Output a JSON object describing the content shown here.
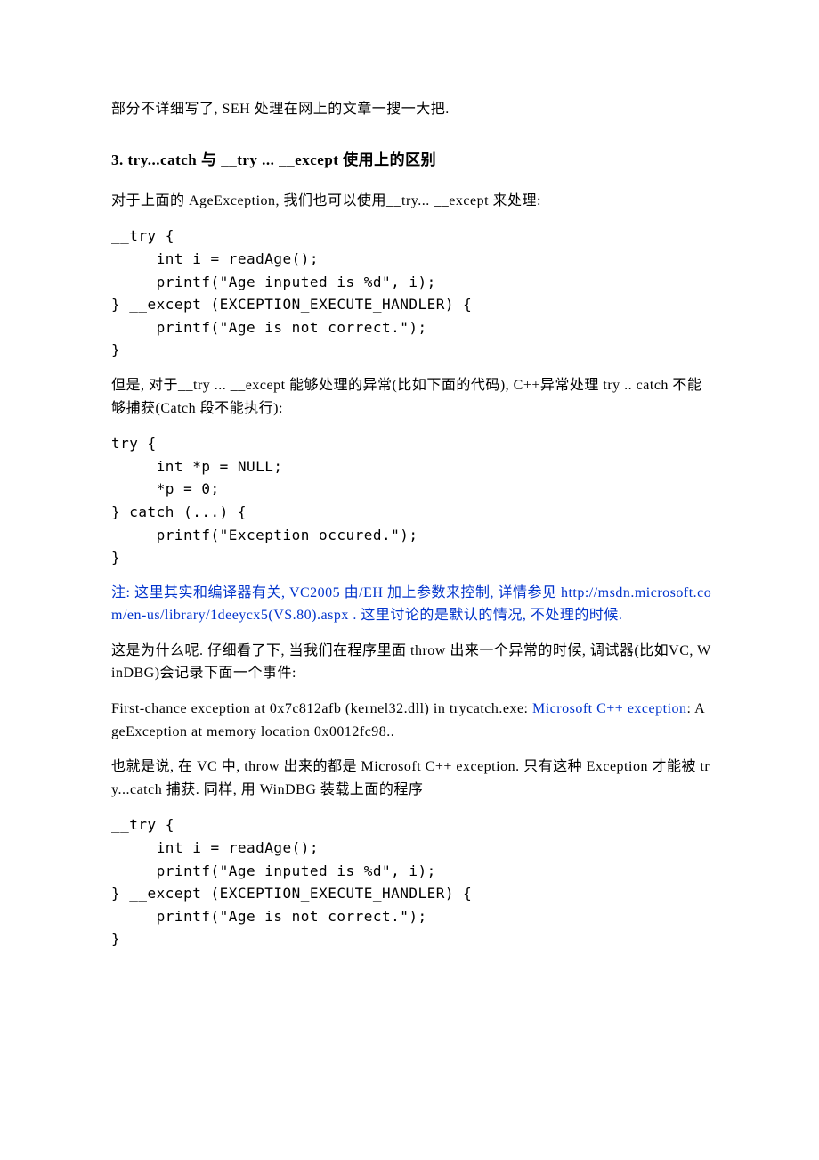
{
  "p_intro": "部分不详细写了, SEH 处理在网上的文章一搜一大把.",
  "heading": "3. try...catch 与 __try ... __except 使用上的区别",
  "p_age": "对于上面的 AgeException, 我们也可以使用__try...  __except 来处理:",
  "code1": "__try {\n     int i = readAge();\n     printf(\"Age inputed is %d\", i);\n} __except (EXCEPTION_EXECUTE_HANDLER) {\n     printf(\"Age is not correct.\");\n}",
  "p_but": "但是, 对于__try ... __except 能够处理的异常(比如下面的代码), C++异常处理 try .. catch 不能够捕获(Catch 段不能执行):",
  "code2": "try {\n     int *p = NULL;\n     *p = 0;\n} catch (...) {\n     printf(\"Exception occured.\");\n}",
  "note_1": "注: 这里其实和编译器有关, VC2005 由/EH 加上参数来控制, 详情参见 http://msdn.microsoft.com/en-us/library/1deeycx5(VS.80).aspx . 这里讨论的是默认的情况, 不处理的时候.",
  "p_why": "这是为什么呢. 仔细看了下, 当我们在程序里面 throw 出来一个异常的时候, 调试器(比如VC, WinDBG)会记录下面一个事件:",
  "fc_prefix": "First-chance exception at 0x7c812afb (kernel32.dll) in trycatch.exe: ",
  "fc_link": "Microsoft C++ exception",
  "fc_suffix": ": AgeException at memory location 0x0012fc98..",
  "p_that": "也就是说, 在 VC 中, throw 出来的都是 Microsoft C++ exception. 只有这种 Exception 才能被 try...catch 捕获. 同样, 用 WinDBG 装载上面的程序",
  "code3": "__try {\n     int i = readAge();\n     printf(\"Age inputed is %d\", i);\n} __except (EXCEPTION_EXECUTE_HANDLER) {\n     printf(\"Age is not correct.\");\n}"
}
